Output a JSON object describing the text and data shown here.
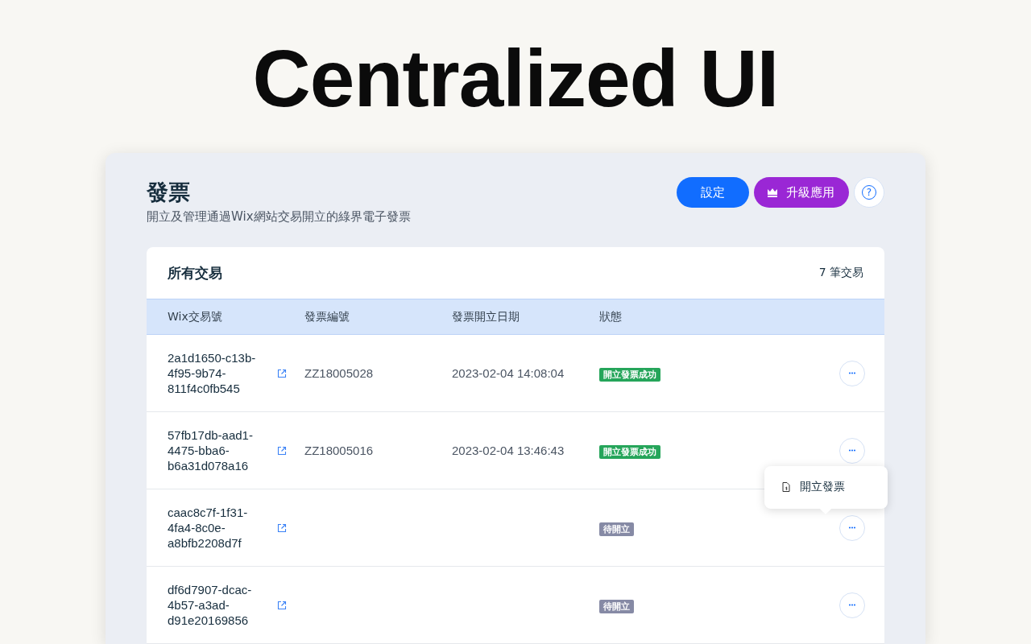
{
  "headline": "Centralized UI",
  "page": {
    "title": "發票",
    "subtitle": "開立及管理通過Wix網站交易開立的綠界電子發票"
  },
  "buttons": [
    {
      "label": "設定",
      "kind": "primary"
    },
    {
      "label": "升級應用",
      "kind": "upgrade"
    },
    {
      "label": "?",
      "kind": "help"
    }
  ],
  "table": {
    "title": "所有交易",
    "count": "7 筆交易",
    "columns": [
      "Wix交易號",
      "發票編號",
      "發票開立日期",
      "狀態"
    ],
    "rows": [
      {
        "transaction": "2a1d1650-c13b-4f95-9b74-811f4c0fb545",
        "invoice": "ZZ18005028",
        "date": "2023-02-04 14:08:04",
        "status": "開立發票成功",
        "kind": "success"
      },
      {
        "transaction": "57fb17db-aad1-4475-bba6-b6a31d078a16",
        "invoice": "ZZ18005016",
        "date": "2023-02-04 13:46:43",
        "status": "開立發票成功",
        "kind": "success"
      },
      {
        "transaction": "caac8c7f-1f31-4fa4-8c0e-a8bfb2208d7f",
        "status": "待開立",
        "kind": "pending",
        "menu": [
          {
            "label": "開立發票"
          }
        ]
      },
      {
        "transaction": "df6d7907-dcac-4b57-a3ad-d91e20169856",
        "status": "待開立",
        "kind": "pending"
      }
    ]
  }
}
